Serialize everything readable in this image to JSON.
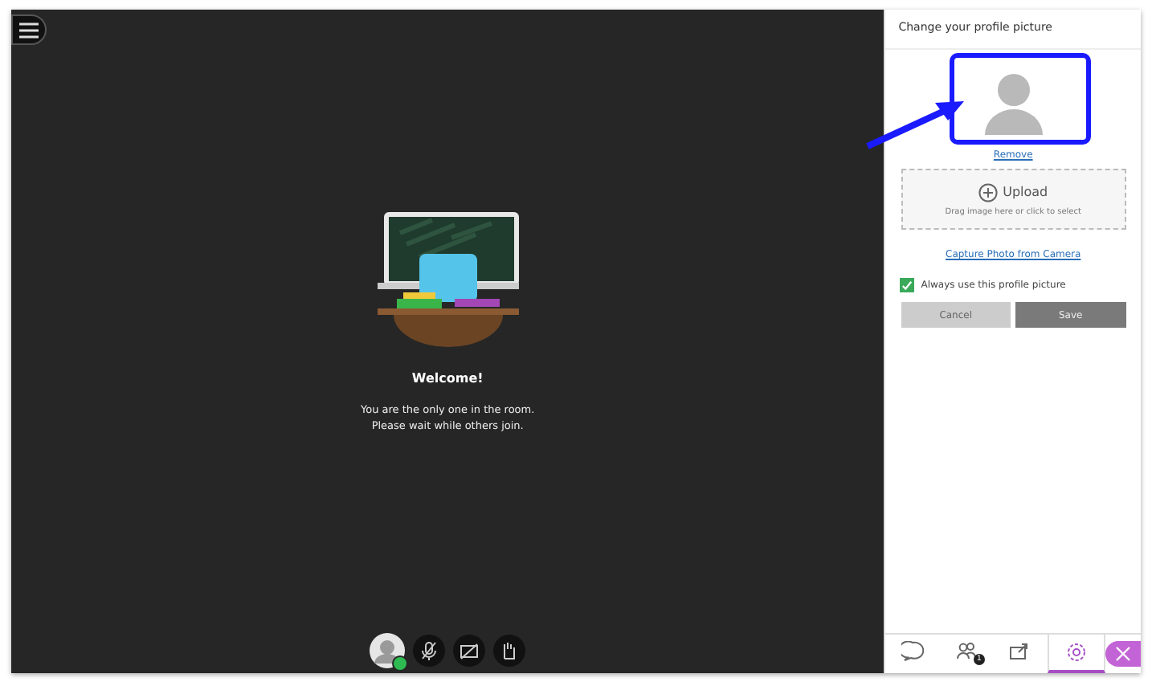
{
  "stage": {
    "welcome_title": "Welcome!",
    "message_lines": [
      "You are the only one in the room.",
      "Please wait while others join."
    ]
  },
  "panel": {
    "title": "Change your profile picture",
    "remove_link": "Remove",
    "upload": {
      "label": "Upload",
      "hint": "Drag image here or click to select"
    },
    "capture_link": "Capture Photo from Camera",
    "always_use": {
      "label": "Always use this profile picture",
      "checked": true
    },
    "buttons": [
      {
        "label": "Cancel",
        "kind": "secondary"
      },
      {
        "label": "Save",
        "kind": "primary"
      }
    ]
  },
  "tabs": [
    {
      "kind": "chat",
      "selected": false
    },
    {
      "kind": "participants",
      "selected": false,
      "badge": "1"
    },
    {
      "kind": "share",
      "selected": false
    },
    {
      "kind": "settings",
      "selected": true
    }
  ]
}
